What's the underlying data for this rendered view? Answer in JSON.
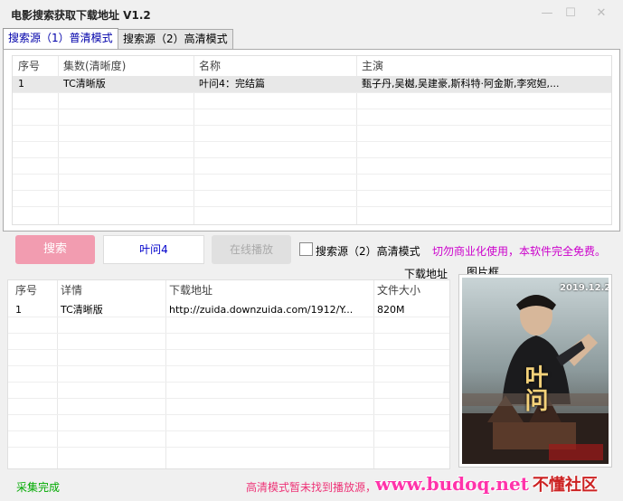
{
  "window": {
    "title": "电影搜索获取下载地址 V1.2",
    "controls": {
      "minimize": "—",
      "maximize": "☐",
      "close": "✕"
    }
  },
  "tabs": [
    {
      "label": "搜索源（1）普清模式",
      "active": true
    },
    {
      "label": "搜索源（2）高清模式",
      "active": false
    }
  ],
  "results_table": {
    "columns": [
      "序号",
      "集数(清晰度)",
      "名称",
      "主演"
    ],
    "rows": [
      {
        "index": "1",
        "episode": "TC清晰版",
        "name": "叶问4：完结篇",
        "cast": "甄子丹,吴樾,吴建豪,斯科特·阿金斯,李宛妲,..."
      }
    ]
  },
  "controls": {
    "search_label": "搜索",
    "search_value": "叶问4",
    "play_label": "在线播放",
    "hd_checkbox_label": "搜索源（2）高清模式",
    "hd_checkbox_checked": false,
    "notice": "切勿商业化使用，本软件完全免费。"
  },
  "labels": {
    "download_section": "下载地址",
    "image_section": "图片框"
  },
  "download_table": {
    "columns": [
      "序号",
      "详情",
      "下载地址",
      "文件大小"
    ],
    "rows": [
      {
        "index": "1",
        "detail": "TC清晰版",
        "url": "http://zuida.downzuida.com/1912/Y...",
        "size": "820M"
      }
    ]
  },
  "poster": {
    "date": "2019.12.20",
    "title": "叶问"
  },
  "status": {
    "left": "采集完成",
    "right": "高清模式暂未找到播放源，"
  },
  "watermark": {
    "site": "www.budoq.net",
    "name": "不懂社区"
  },
  "colors": {
    "search_button": "#f29cb0",
    "notice": "#cc00cc",
    "status_ok": "#00aa00",
    "status_warn": "#ee3377",
    "active_tab_text": "#0000aa"
  }
}
